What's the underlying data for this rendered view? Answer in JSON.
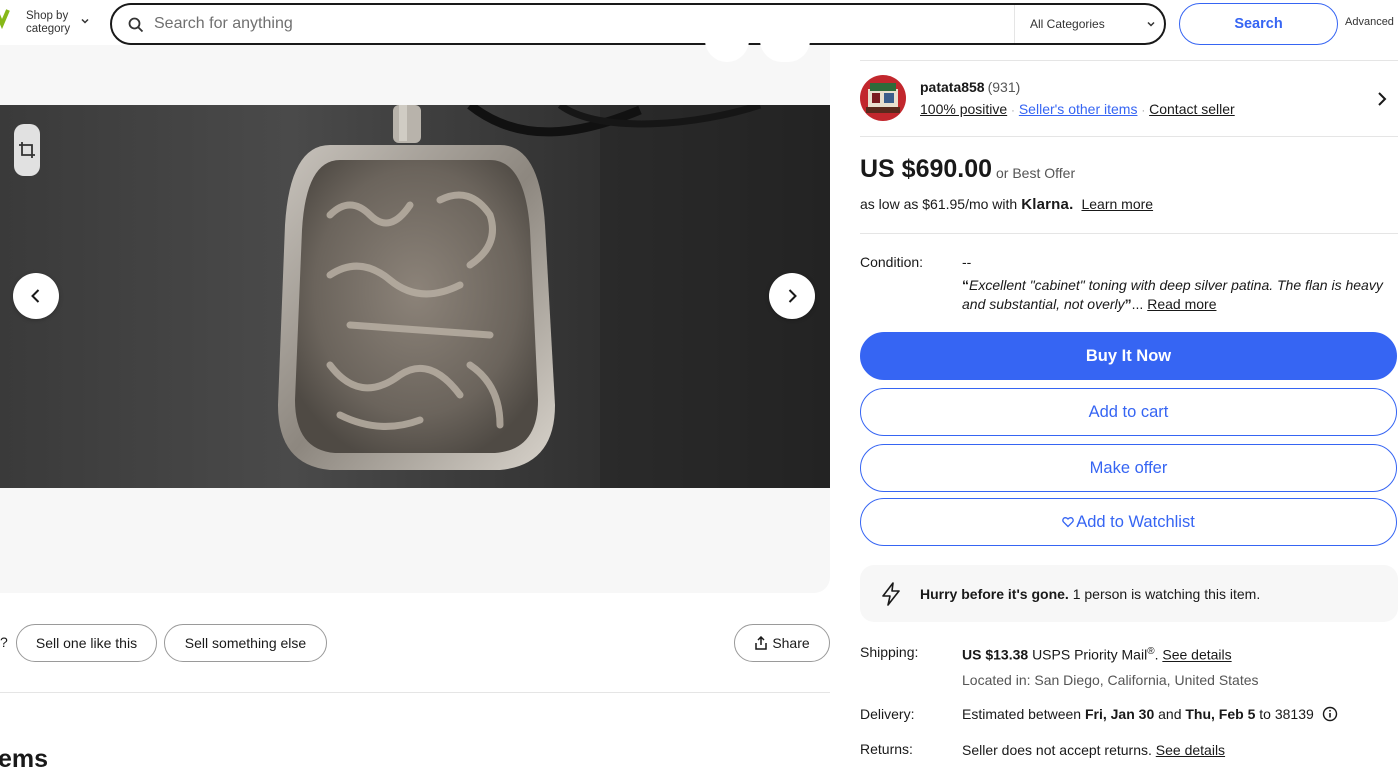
{
  "header": {
    "shop_by_line1": "Shop by",
    "shop_by_line2": "category",
    "search_placeholder": "Search for anything",
    "category_selected": "All Categories",
    "search_button": "Search",
    "advanced_link": "Advanced"
  },
  "colors": {
    "primary_blue": "#3665f3",
    "text": "#191919",
    "muted": "#555555",
    "divider": "#e5e5e5",
    "panel": "#f7f7f7"
  },
  "gallery": {
    "actions": {
      "question_fragment": "?",
      "sell_one_like_this": "Sell one like this",
      "sell_something_else": "Sell something else",
      "share": "Share"
    },
    "section_heading_fragment": "ems"
  },
  "seller": {
    "name": "patata858",
    "feedback_count": "(931)",
    "positive": "100% positive",
    "other_items": "Seller's other items",
    "contact": "Contact seller"
  },
  "pricing": {
    "price": "US $690.00",
    "best_offer": "or Best Offer",
    "installment_text": "as low as $61.95/mo with",
    "klarna_brand": "Klarna.",
    "learn_more": "Learn more"
  },
  "condition": {
    "label": "Condition:",
    "value": "--",
    "quote_open": "“",
    "quote": "Excellent \"cabinet\" toning with deep silver patina. The flan is heavy and substantial, not overly",
    "quote_close": "”",
    "ellipsis": "...",
    "read_more": "Read more"
  },
  "actions": {
    "buy_now": "Buy It Now",
    "add_to_cart": "Add to cart",
    "make_offer": "Make offer",
    "watchlist": "Add to Watchlist"
  },
  "urgency": {
    "bold": "Hurry before it's gone.",
    "text": "1 person is watching this item."
  },
  "shipping": {
    "label": "Shipping:",
    "price": "US $13.38",
    "service": "USPS Priority Mail",
    "registered": "®",
    "period": ".",
    "see_details": "See details",
    "location": "Located in: San Diego, California, United States"
  },
  "delivery": {
    "label": "Delivery:",
    "prefix": "Estimated between",
    "start": "Fri, Jan 30",
    "and": "and",
    "end": "Thu, Feb 5",
    "to": "to 38139"
  },
  "returns": {
    "label": "Returns:",
    "text": "Seller does not accept returns.",
    "see_details": "See details"
  }
}
